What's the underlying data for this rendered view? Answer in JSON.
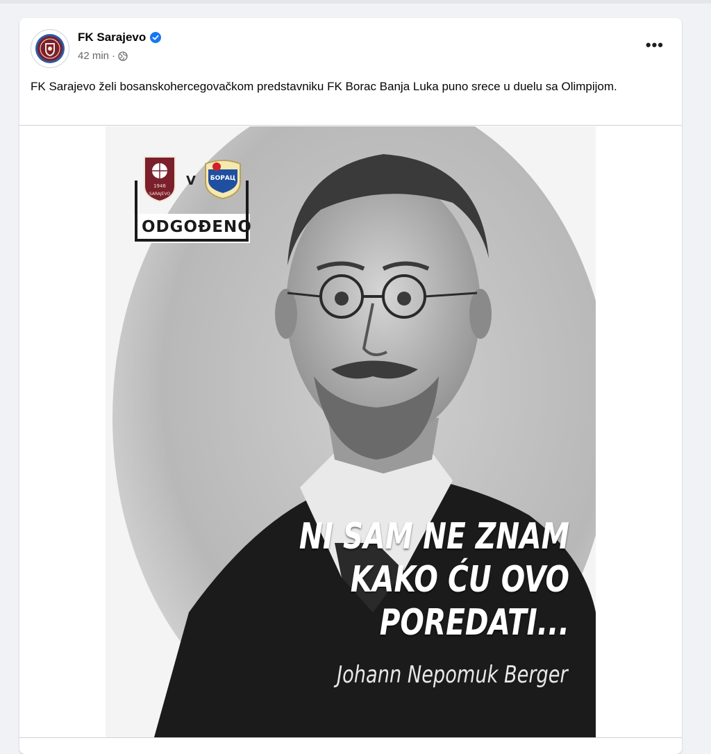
{
  "post": {
    "author": "FK Sarajevo",
    "time": "42 min",
    "separator": "·",
    "text": "FK Sarajevo želi bosanskohercegovačkom predstavniku FK Borac Banja Luka puno srece u duelu sa Olimpijom.",
    "more_label": "•••"
  },
  "image": {
    "badge_label": "ODGOĐENO",
    "versus": "V",
    "crest_year": "1946",
    "crest_text": "SARAJEVO",
    "borac_text": "БОРАЦ",
    "quote_lines": [
      "NI SAM NE ZNAM",
      "KAKO ĆU OVO",
      "POREDATI..."
    ],
    "quote_author": "Johann Nepomuk Berger"
  },
  "colors": {
    "verified": "#1877f2",
    "sarajevo_maroon": "#7a1f2b",
    "borac_blue": "#1f4fa0",
    "borac_red": "#d0202a"
  },
  "icons": [
    "fk-sarajevo-logo-icon",
    "verified-badge-icon",
    "globe-icon",
    "more-options-icon"
  ]
}
